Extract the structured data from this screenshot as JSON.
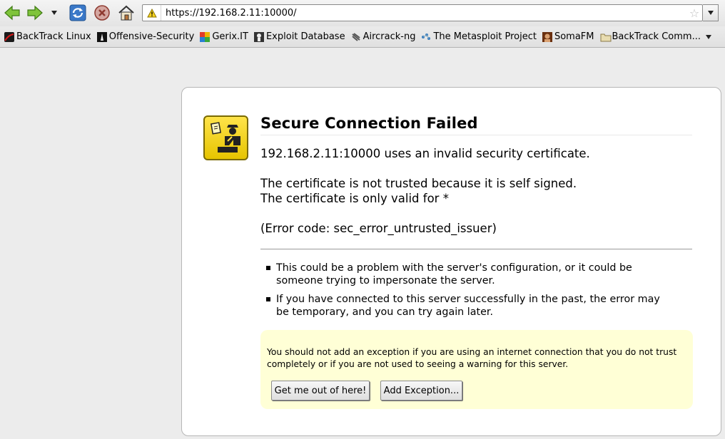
{
  "toolbar": {
    "url": "https://192.168.2.11:10000/"
  },
  "bookmarks": [
    {
      "label": "BackTrack Linux",
      "icon": "backtrack-icon",
      "color": "#c01010"
    },
    {
      "label": "Offensive-Security",
      "icon": "offsec-icon",
      "color": "#222222"
    },
    {
      "label": "Gerix.IT",
      "icon": "gerix-icon",
      "color": "#2a7fd4"
    },
    {
      "label": "Exploit Database",
      "icon": "exploitdb-icon",
      "color": "#444444"
    },
    {
      "label": "Aircrack-ng",
      "icon": "aircrack-icon",
      "color": "#555555"
    },
    {
      "label": "The Metasploit Project",
      "icon": "metasploit-icon",
      "color": "#3a7fc0"
    },
    {
      "label": "SomaFM",
      "icon": "somafm-icon",
      "color": "#6a3010"
    },
    {
      "label": "BackTrack Comm...",
      "icon": "folder-icon",
      "color": "#c8b87a"
    }
  ],
  "error": {
    "title": "Secure Connection Failed",
    "line1": "192.168.2.11:10000 uses an invalid security certificate.",
    "line2": "The certificate is not trusted because it is self signed.",
    "line3": "The certificate is only valid for *",
    "code": "(Error code: sec_error_untrusted_issuer)",
    "bullets": [
      "This could be a problem with the server's configuration, or it could be someone trying to impersonate the server.",
      "If you have connected to this server successfully in the past, the error may be temporary, and you can try again later."
    ],
    "warning": "You should not add an exception if you are using an internet connection that you do not trust completely or if you are not used to seeing a warning for this server.",
    "get_out_label": "Get me out of here!",
    "add_exception_label": "Add Exception..."
  }
}
